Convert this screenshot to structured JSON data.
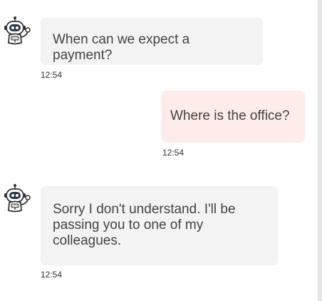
{
  "chat": {
    "messages": [
      {
        "sender": "bot",
        "text": "When can we expect a payment?",
        "time": "12:54"
      },
      {
        "sender": "user",
        "text": "Where is the office?",
        "time": "12:54"
      },
      {
        "sender": "bot",
        "text": "Sorry I don't understand. I'll be passing you to one of my colleagues.",
        "time": "12:54"
      }
    ]
  },
  "colors": {
    "bot_bubble": "#f3f3f3",
    "user_bubble": "#fdecea",
    "text": "#444444"
  }
}
